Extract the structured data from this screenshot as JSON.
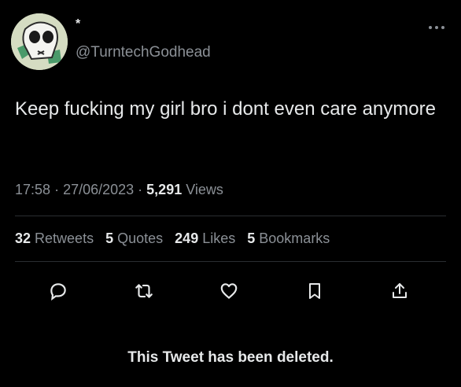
{
  "author": {
    "display_name": "*",
    "handle": "@TurntechGodhead",
    "avatar_icon": "skull-avatar-icon"
  },
  "tweet": {
    "text": "Keep fucking my girl bro i dont even care anymore",
    "time": "17:58",
    "date": "27/06/2023",
    "views_count": "5,291",
    "views_label": "Views"
  },
  "stats": {
    "retweets_count": "32",
    "retweets_label": "Retweets",
    "quotes_count": "5",
    "quotes_label": "Quotes",
    "likes_count": "249",
    "likes_label": "Likes",
    "bookmarks_count": "5",
    "bookmarks_label": "Bookmarks"
  },
  "actions": {
    "reply_icon": "reply-icon",
    "retweet_icon": "retweet-icon",
    "like_icon": "heart-icon",
    "bookmark_icon": "bookmark-icon",
    "share_icon": "share-icon"
  },
  "banner": {
    "text": "This Tweet has been deleted."
  },
  "colors": {
    "background": "#000000",
    "primary_text": "#e7e9ea",
    "secondary_text": "#8b9096",
    "divider": "#2a2d31",
    "avatar_bg": "#d5dcc2",
    "avatar_accent": "#4a9a6a"
  }
}
